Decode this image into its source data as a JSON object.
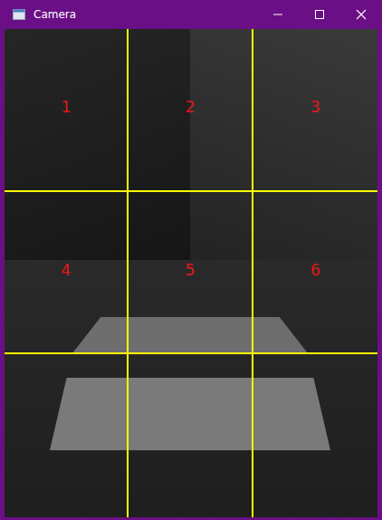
{
  "window": {
    "title": "Camera"
  },
  "grid": {
    "zones": [
      "1",
      "2",
      "3",
      "4",
      "5",
      "6"
    ]
  }
}
